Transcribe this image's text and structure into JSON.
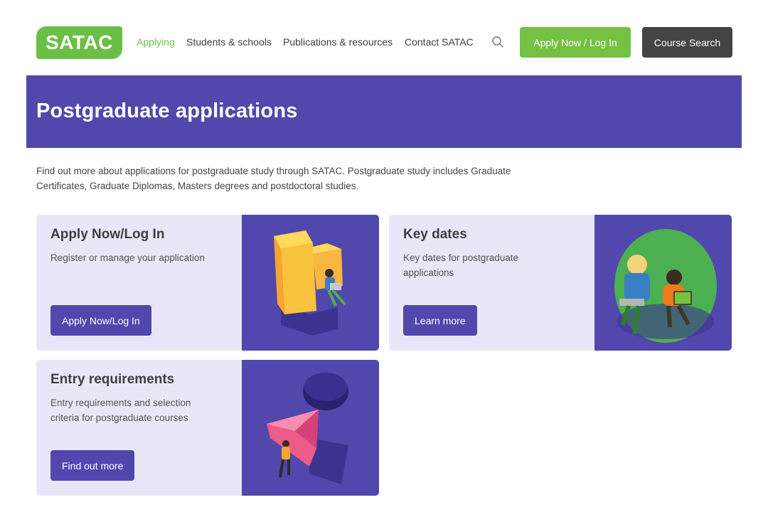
{
  "header": {
    "logo_text": "SATAC",
    "nav": [
      "Applying",
      "Students & schools",
      "Publications & resources",
      "Contact SATAC"
    ],
    "apply_label": "Apply Now / Log In",
    "course_search_label": "Course Search"
  },
  "banner": {
    "title": "Postgraduate applications"
  },
  "intro": "Find out more about applications for postgraduate study through SATAC. Postgraduate study includes Graduate Certificates, Graduate Diplomas, Masters degrees and postdoctoral studies.",
  "cards": [
    {
      "title": "Apply Now/Log In",
      "desc": "Register or manage your application",
      "cta": "Apply Now/Log In"
    },
    {
      "title": "Key dates",
      "desc": "Key dates for postgraduate applications",
      "cta": "Learn more"
    },
    {
      "title": "Entry requirements",
      "desc": "Entry requirements and selection criteria for postgraduate courses",
      "cta": "Find out more"
    }
  ],
  "colors": {
    "brand_green": "#6cbf45",
    "brand_purple": "#5147ad",
    "card_bg": "#e9e7f7",
    "dark_button": "#444444"
  }
}
